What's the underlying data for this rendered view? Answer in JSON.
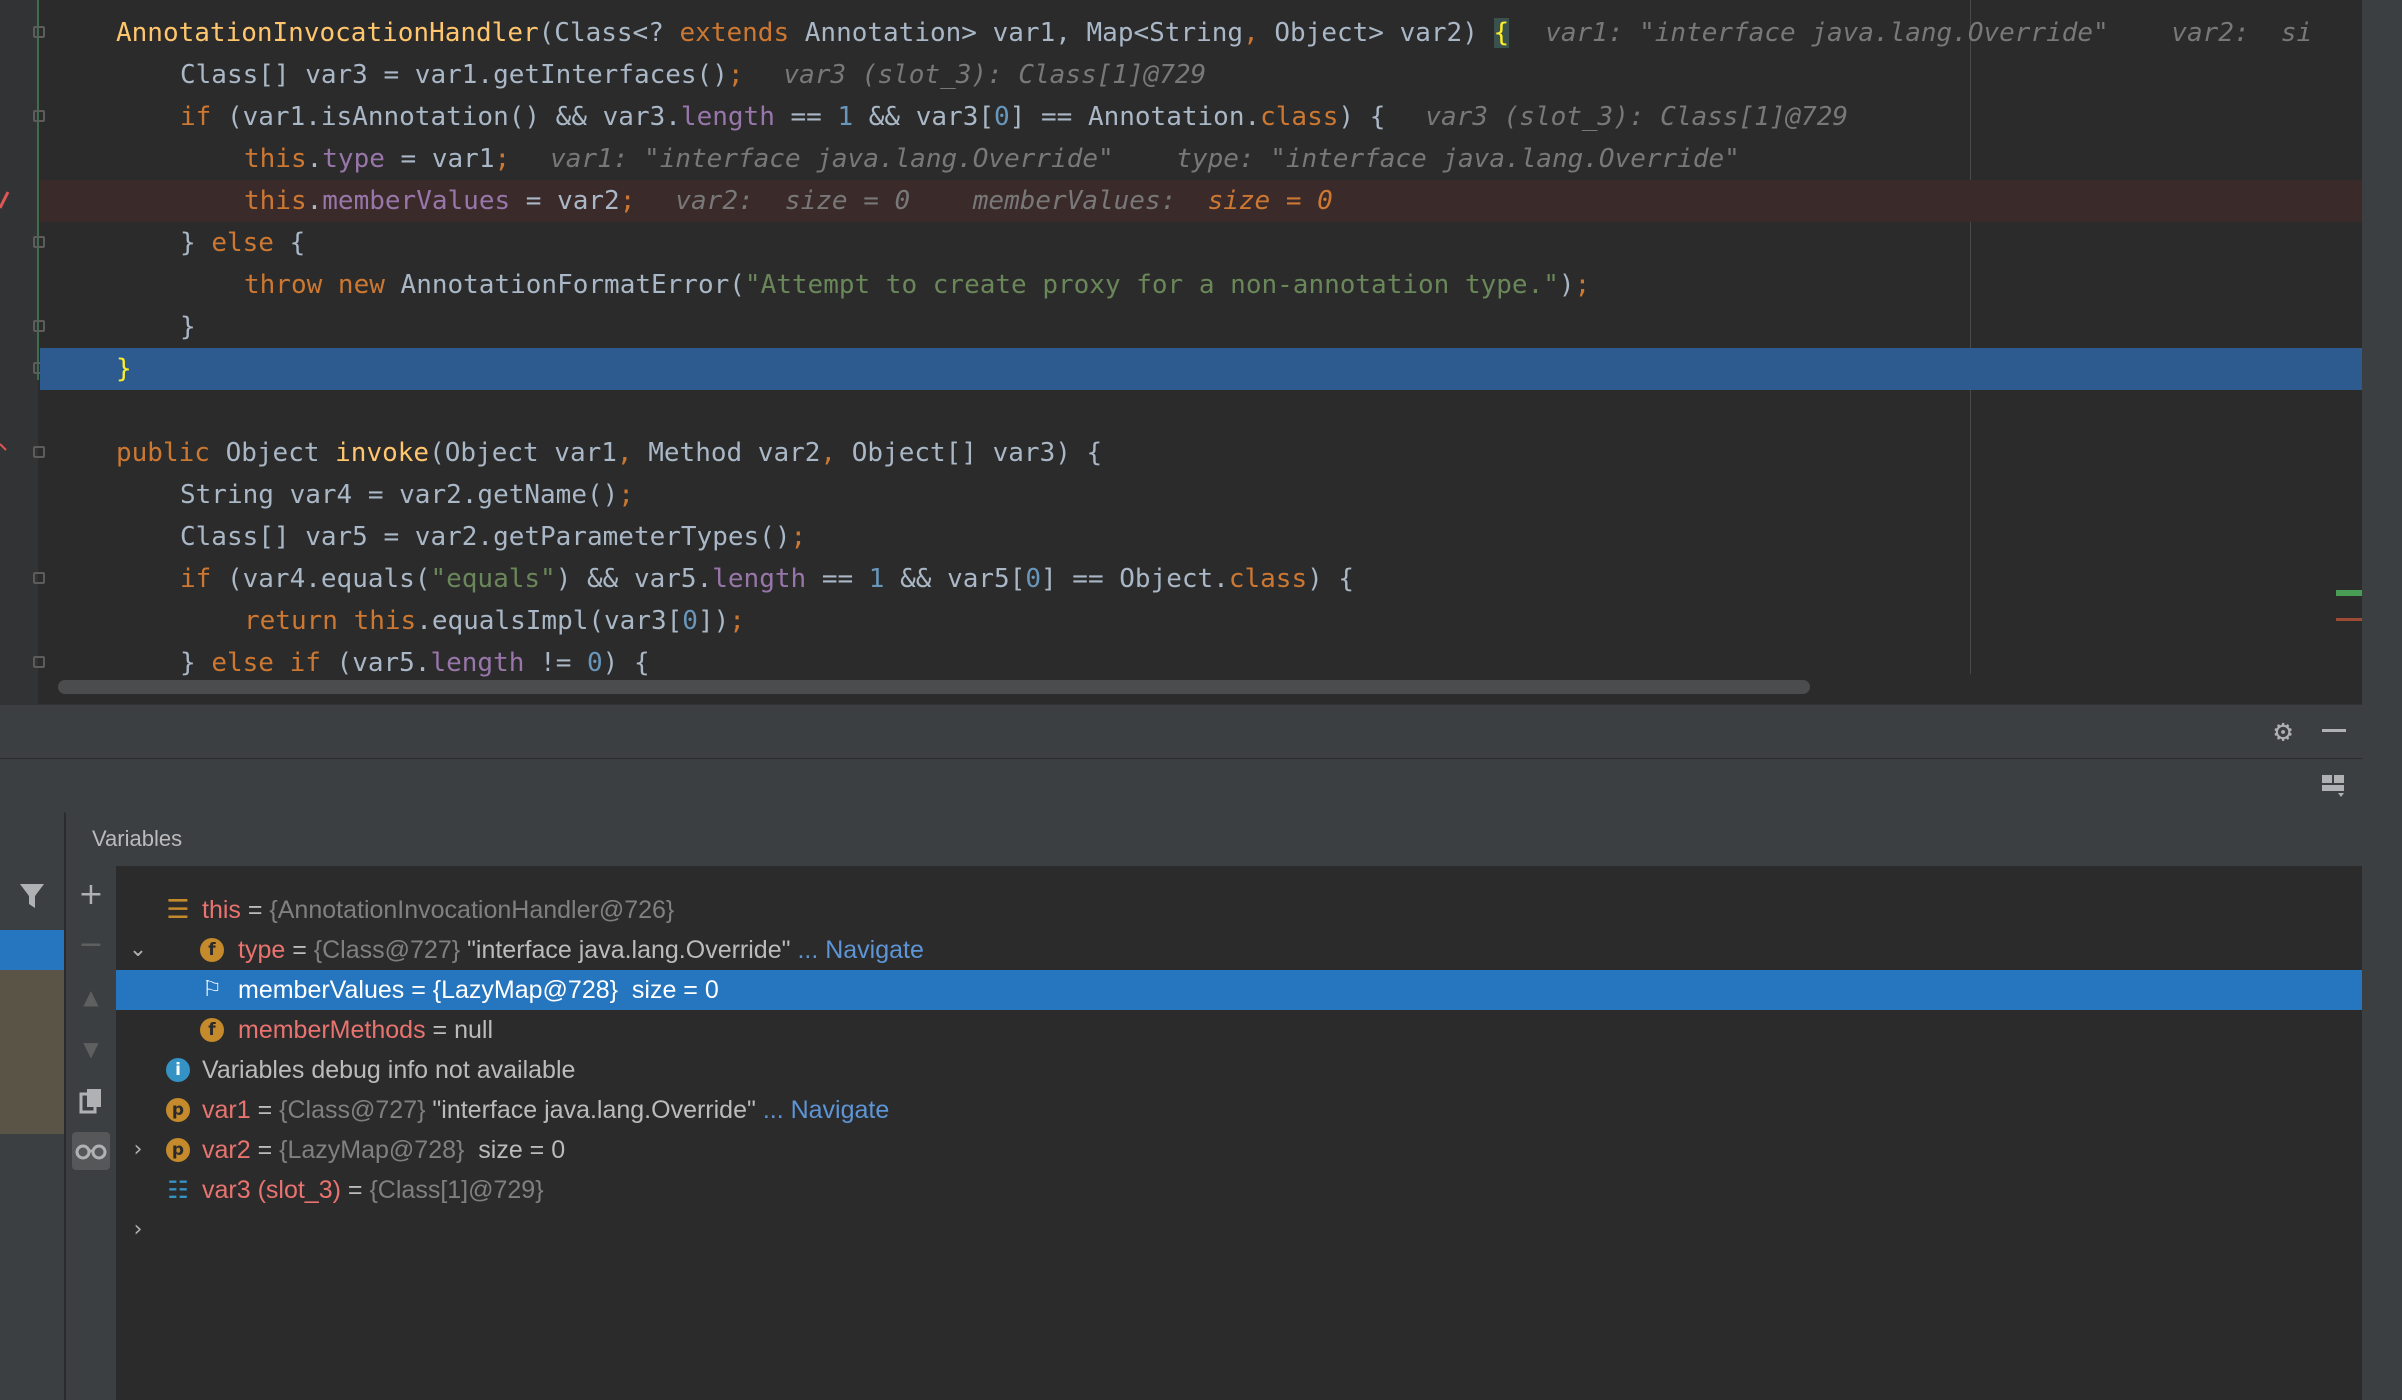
{
  "editor": {
    "lines": [
      {
        "text": "AnnotationInvocationHandler(Class<? extends Annotation> var1, Map<String, Object> var2) {",
        "hint": "var1: \"interface java.lang.Override\"    var2:  si"
      },
      {
        "text": "Class[] var3 = var1.getInterfaces();",
        "hint": "var3 (slot_3): Class[1]@729"
      },
      {
        "text": "if (var1.isAnnotation() && var3.length == 1 && var3[0] == Annotation.class) {",
        "hint": "var3 (slot_3): Class[1]@729"
      },
      {
        "text": "this.type = var1;",
        "hint": "var1: \"interface java.lang.Override\"    type: \"interface java.lang.Override\""
      },
      {
        "text": "this.memberValues = var2;",
        "hint": "var2:  size = 0    memberValues:",
        "hint_red": "size = 0"
      },
      {
        "text": "} else {"
      },
      {
        "text": "throw new AnnotationFormatError(\"Attempt to create proxy for a non-annotation type.\");"
      },
      {
        "text": "}"
      },
      {
        "text": "}"
      },
      {
        "text": ""
      },
      {
        "text": "public Object invoke(Object var1, Method var2, Object[] var3) {"
      },
      {
        "text": "String var4 = var2.getName();"
      },
      {
        "text": "Class[] var5 = var2.getParameterTypes();"
      },
      {
        "text": "if (var4.equals(\"equals\") && var5.length == 1 && var5[0] == Object.class) {"
      },
      {
        "text": "return this.equalsImpl(var3[0]);"
      },
      {
        "text": "} else if (var5.length != 0) {"
      }
    ]
  },
  "debugger": {
    "settings_icon": "gear-icon",
    "minimize_icon": "minus-icon",
    "variables_title": "Variables",
    "toolbar_icons": [
      "plus-icon",
      "minus-icon",
      "arrow-up-icon",
      "arrow-down-icon",
      "copy-icon",
      "glasses-icon"
    ],
    "variables": [
      {
        "name": "this",
        "eq": " = ",
        "value": "{AnnotationInvocationHandler@726}",
        "icon": "this-icon",
        "expanded": true
      },
      {
        "name": "type",
        "eq": " = ",
        "value_ref": "{Class@727}",
        "value": " \"interface java.lang.Override\"",
        "navigate": " ... Navigate",
        "icon": "field-icon",
        "icon_letter": "f",
        "collapsed": true
      },
      {
        "name": "memberValues = {LazyMap@728}  size = 0",
        "icon": "flag-icon",
        "selected": true
      },
      {
        "name": "memberMethods",
        "eq": " = ",
        "value": "null",
        "icon": "field-icon",
        "icon_letter": "f"
      },
      {
        "name": "Variables debug info not available",
        "icon": "info-icon",
        "icon_letter": "i"
      },
      {
        "name": "var1",
        "eq": " = ",
        "value_ref": "{Class@727}",
        "value": " \"interface java.lang.Override\"",
        "navigate": " ... Navigate",
        "icon": "param-icon",
        "icon_letter": "p",
        "collapsed": true
      },
      {
        "name": "var2",
        "eq": " = ",
        "value_ref": "{LazyMap@728}",
        "value": "  size = 0",
        "icon": "param-icon",
        "icon_letter": "p"
      },
      {
        "name": "var3 (slot_3)",
        "eq": " = ",
        "value_ref": "{Class[1]@729}",
        "icon": "array-icon",
        "collapsed": true
      }
    ]
  },
  "colors": {
    "editor_bg": "#2b2b2b",
    "keyword": "#cc7832",
    "string": "#6a8759",
    "number": "#6897bb",
    "field": "#9876aa",
    "selection": "#2675bf",
    "var_name": "#e8736f"
  }
}
